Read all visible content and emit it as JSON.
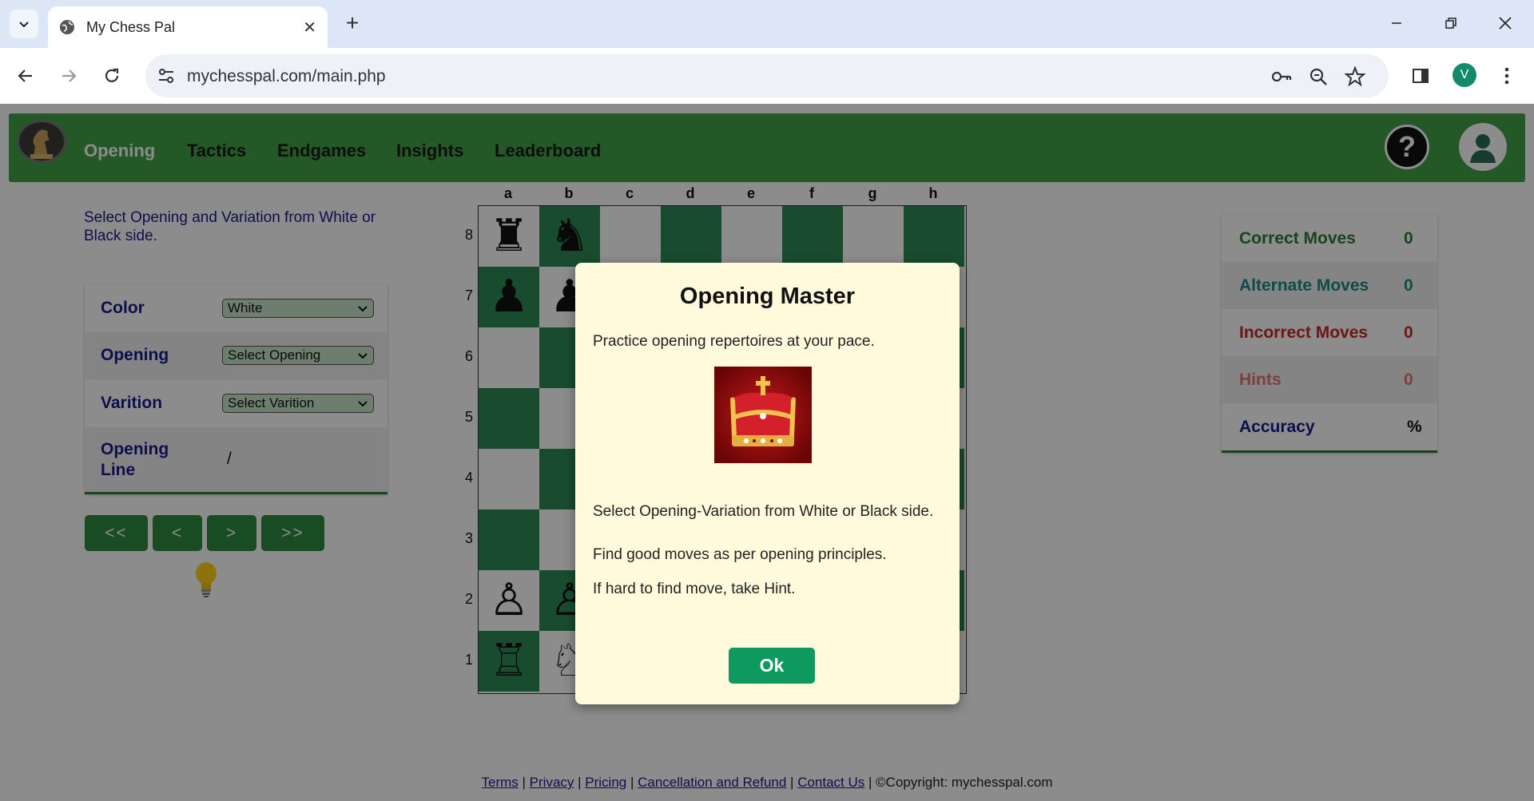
{
  "browser": {
    "tab_title": "My Chess Pal",
    "url": "mychesspal.com/main.php",
    "profile_initial": "V"
  },
  "nav": {
    "items": [
      "Opening",
      "Tactics",
      "Endgames",
      "Insights",
      "Leaderboard"
    ],
    "active": "Opening",
    "help_label": "?"
  },
  "intro_text": "Select Opening and Variation from White or Black side.",
  "form": {
    "color_label": "Color",
    "color_value": "White",
    "opening_label": "Opening",
    "opening_value": "Select Opening",
    "variation_label": "Varition",
    "variation_value": "Select Varition",
    "line_label": "Opening Line",
    "line_value": "/"
  },
  "controls": {
    "first": "<<",
    "prev": "<",
    "next": ">",
    "last": ">>"
  },
  "board": {
    "files": [
      "a",
      "b",
      "c",
      "d",
      "e",
      "f",
      "g",
      "h"
    ],
    "ranks": [
      "8",
      "7",
      "6",
      "5",
      "4",
      "3",
      "2",
      "1"
    ],
    "rows": [
      [
        "♜",
        "♞",
        "",
        "",
        "",
        "",
        "",
        ""
      ],
      [
        "♟",
        "♟",
        "",
        "",
        "",
        "",
        "",
        ""
      ],
      [
        "",
        "",
        "",
        "",
        "",
        "",
        "",
        ""
      ],
      [
        "",
        "",
        "",
        "",
        "",
        "",
        "",
        ""
      ],
      [
        "",
        "",
        "",
        "",
        "",
        "",
        "",
        ""
      ],
      [
        "",
        "",
        "",
        "",
        "",
        "",
        "",
        ""
      ],
      [
        "♙",
        "♙",
        "♙",
        "♙",
        "♙",
        "♙",
        "♙",
        "♙"
      ],
      [
        "♖",
        "♘",
        "♗",
        "♕",
        "♔",
        "♗",
        "♘",
        "♖"
      ]
    ]
  },
  "stats": {
    "correct_label": "Correct Moves",
    "correct_value": "0",
    "alternate_label": "Alternate Moves",
    "alternate_value": "0",
    "incorrect_label": "Incorrect Moves",
    "incorrect_value": "0",
    "hints_label": "Hints",
    "hints_value": "0",
    "accuracy_label": "Accuracy",
    "accuracy_value": "%",
    "colors": {
      "correct": "#2e7d32",
      "alternate": "#1a8a8a",
      "incorrect": "#c62828",
      "hints": "#e57373",
      "accuracy": "#1a1a8c"
    }
  },
  "footer": {
    "links": [
      "Terms",
      "Privacy",
      "Pricing",
      "Cancellation and Refund",
      "Contact Us"
    ],
    "copyright": "©Copyright: mychesspal.com"
  },
  "modal": {
    "title": "Opening Master",
    "subtitle": "Practice opening repertoires at your pace.",
    "p1": "Select Opening-Variation from White or Black side.",
    "p2": "Find good moves as per opening principles.",
    "p3": "If hard to find move, take Hint.",
    "ok_label": "Ok"
  }
}
